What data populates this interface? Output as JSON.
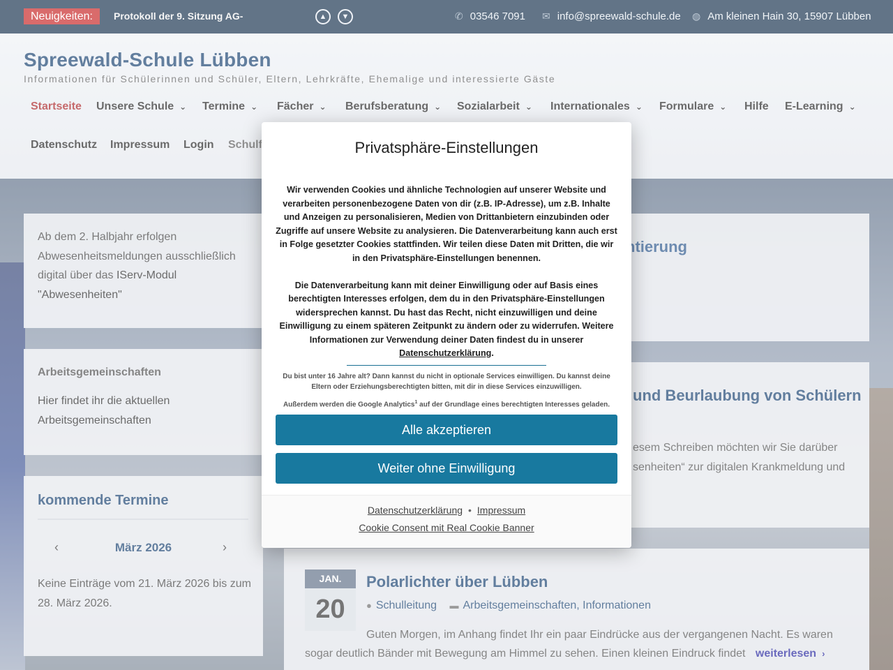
{
  "topbar": {
    "news_label": "Neuigkeiten:",
    "news_text": "Protokoll der 9. Sitzung AG-",
    "phone": "03546 7091",
    "email": "info@spreewald-schule.de",
    "address": "Am kleinen Hain 30, 15907 Lübben"
  },
  "header": {
    "title": "Spreewald-Schule Lübben",
    "tagline": "Informationen für Schülerinnen und Schüler, Eltern, Lehrkräfte, Ehemalige und interessierte Gäste"
  },
  "nav": {
    "row1": [
      "Startseite",
      "Unsere Schule",
      "Termine",
      "Fächer",
      "Berufsberatung",
      "Sozialarbeit",
      "Internationales",
      "Formulare",
      "Hilfe",
      "E-Learning"
    ],
    "row2": [
      "Datenschutz",
      "Impressum",
      "Login",
      "Schulfi"
    ]
  },
  "sidebar": {
    "notice": {
      "t1": "Ab dem 2. Halbjahr erfolgen",
      "t2": "Abwesenheitsmeldungen ausschließlich",
      "t3": "digital über das ",
      "link": "IServ-Modul",
      "t4": "\"Abwesenheiten\""
    },
    "ag": {
      "heading": "Arbeitsgemeinschaften",
      "l1": "Hier findet ihr die aktuellen",
      "l2": "Arbeitsgemeinschaften"
    },
    "events": {
      "heading": "kommende Termine",
      "month": "März 2026",
      "empty1": "Keine Einträge vom 21. März 2026 bis zum",
      "empty2": "28. März 2026."
    }
  },
  "posts": {
    "p1_title_fragment": "ntierung",
    "p2_title_fragment": "und Beurlaubung von Schülern",
    "p2_excerpt1": "esem Schreiben möchten wir Sie darüber",
    "p2_excerpt2": "senheiten“ zur digitalen Krankmeldung und",
    "p3": {
      "month": "JAN.",
      "day": "20",
      "title": "Polarlichter über Lübben",
      "author": "Schulleitung",
      "cat1": "Arbeitsgemeinschaften",
      "cat2": "Informationen",
      "excerpt1": "Guten Morgen, im Anhang findet Ihr ein paar Eindrücke aus der vergangenen Nacht. Es waren",
      "excerpt2": "sogar deutlich Bänder mit Bewegung am Himmel zu sehen. Einen kleinen Eindruck findet",
      "read_more": "weiterlesen"
    }
  },
  "modal": {
    "title": "Privatsphäre-Einstellungen",
    "para1": "Wir verwenden Cookies und ähnliche Technologien auf unserer Website und verarbeiten personenbezogene Daten von dir (z.B. IP-Adresse), um z.B. Inhalte und Anzeigen zu personalisieren, Medien von Drittanbietern einzubinden oder Zugriffe auf unsere Website zu analysieren. Die Datenverarbeitung kann auch erst in Folge gesetzter Cookies stattfinden. Wir teilen diese Daten mit Dritten, die wir in den Privatsphäre-Einstellungen benennen.",
    "para2": "Die Datenverarbeitung kann mit deiner Einwilligung oder auf Basis eines berechtigten Interesses erfolgen, dem du in den Privatsphäre-Einstellungen widersprechen kannst. Du hast das Recht, nicht einzuwilligen und deine Einwilligung zu einem späteren Zeitpunkt zu ändern oder zu widerrufen. Weitere Informationen zur Verwendung deiner Daten findest du in unserer",
    "para2_link": "Datenschutzerklärung",
    "para2_end": ".",
    "small1": "Du bist unter 16 Jahre alt? Dann kannst du nicht in optionale Services einwilligen. Du kannst deine Eltern oder Erziehungsberechtigten bitten, mit dir in diese Services einzuwilligen.",
    "small2": "Außerdem werden die Google Analytics",
    "small2_sup": "1",
    "small2_end": " auf der Grundlage eines berechtigten Interesses geladen.",
    "accept_all": "Alle akzeptieren",
    "continue_without": "Weiter ohne Einwilligung",
    "footer_privacy": "Datenschutzerklärung",
    "footer_sep": "•",
    "footer_imprint": "Impressum",
    "footer_credit": "Cookie Consent mit Real Cookie Banner"
  },
  "colors": {
    "brand_navy": "#0e2a47",
    "title_blue": "#0e3a6b",
    "active_red": "#a6191c",
    "news_red": "#c51c1c",
    "button_teal": "#18799f"
  }
}
